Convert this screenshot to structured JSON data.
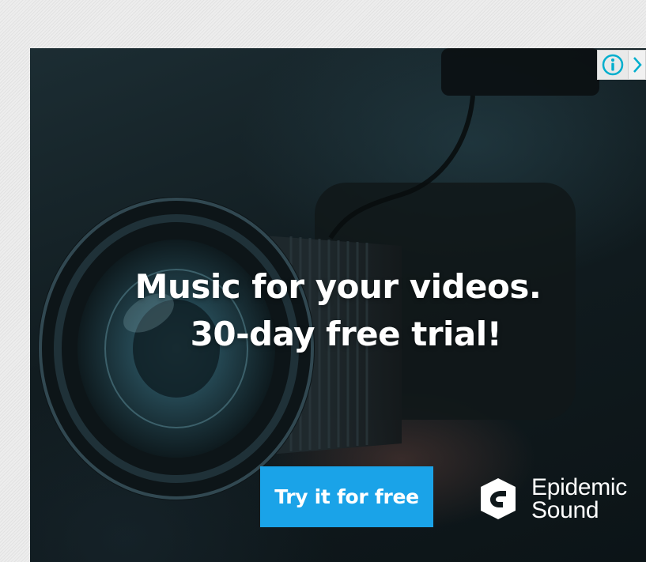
{
  "ad": {
    "headline_line1": "Music for your videos.",
    "headline_line2": "30-day free trial!",
    "cta_label": "Try it for free",
    "brand_line1": "Epidemic",
    "brand_line2": "Sound"
  },
  "icons": {
    "adchoices_info": "info-icon",
    "adchoices_close": "close-icon",
    "brand_logo": "epidemic-sound-logo-icon"
  },
  "colors": {
    "cta_background": "#1aa3e8",
    "adchoices_accent": "#00aecd",
    "headline_text": "#ffffff",
    "page_background": "#ececec"
  }
}
